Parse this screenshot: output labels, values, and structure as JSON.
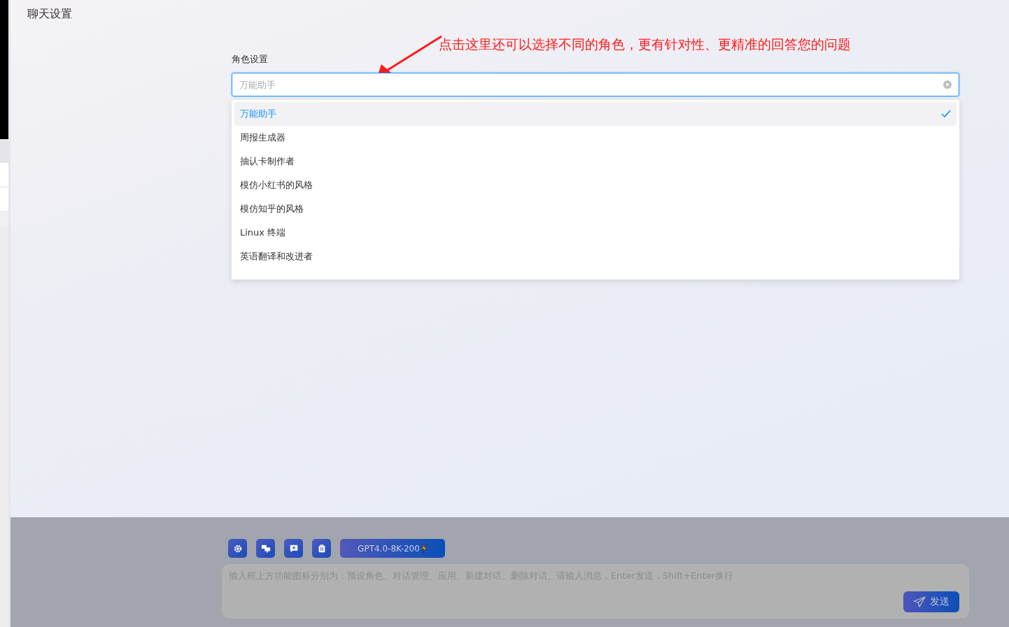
{
  "page_title": "聊天设置",
  "annotation": {
    "text": "点击这里还可以选择不同的角色，更有针对性、更精准的回答您的问题"
  },
  "role_select": {
    "label": "角色设置",
    "placeholder": "万能助手",
    "options": [
      {
        "label": "万能助手",
        "selected": true
      },
      {
        "label": "周报生成器",
        "selected": false
      },
      {
        "label": "抽认卡制作者",
        "selected": false
      },
      {
        "label": "模仿小红书的风格",
        "selected": false
      },
      {
        "label": "模仿知乎的风格",
        "selected": false
      },
      {
        "label": "Linux 终端",
        "selected": false
      },
      {
        "label": "英语翻译和改进者",
        "selected": false
      }
    ]
  },
  "toolbar": {
    "buttons": [
      {
        "kind": "settings"
      },
      {
        "kind": "chats"
      },
      {
        "kind": "apps"
      },
      {
        "kind": "delete"
      }
    ],
    "model": "GPT4.0-8K-200"
  },
  "composer": {
    "placeholder": "输入框上方功能图标分别为：预设角色、对话管理、应用、新建对话、删除对话。请输入消息，Enter发送，Shift+Enter换行",
    "send": "发送"
  }
}
